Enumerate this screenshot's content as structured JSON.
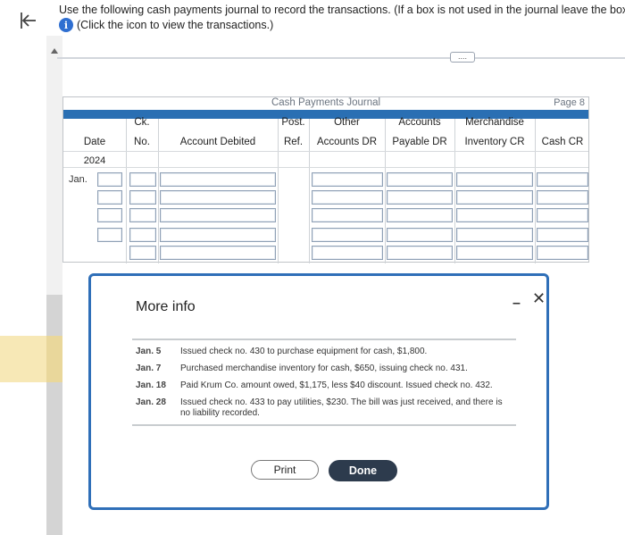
{
  "instructions": "Use the following cash payments journal to record the transactions. (If a box is not used in the journal leave the box empty; do not s",
  "info_link": "(Click the icon to view the transactions.)",
  "journal": {
    "title": "Cash Payments Journal",
    "page": "Page 8",
    "headers": {
      "date": "Date",
      "year": "2024",
      "ck_top": "Ck.",
      "ck_bottom": "No.",
      "account_debited": "Account Debited",
      "post_top": "Post.",
      "post_bottom": "Ref.",
      "other_top": "Other",
      "other_bottom": "Accounts DR",
      "ap_top": "Accounts",
      "ap_bottom": "Payable DR",
      "merch_top": "Merchandise",
      "merch_bottom": "Inventory CR",
      "cash": "Cash CR"
    },
    "month": "Jan."
  },
  "modal": {
    "title": "More info",
    "transactions": [
      {
        "date": "Jan. 5",
        "text": "Issued check no. 430 to purchase equipment for cash, $1,800."
      },
      {
        "date": "Jan. 7",
        "text": "Purchased merchandise inventory for cash, $650, issuing check no. 431."
      },
      {
        "date": "Jan. 18",
        "text": "Paid Krum Co. amount owed, $1,175, less $40 discount. Issued check no. 432."
      },
      {
        "date": "Jan. 28",
        "text": "Issued check no. 433 to pay utilities, $230. The bill was just received, and there is no liability recorded."
      }
    ],
    "print_label": "Print",
    "done_label": "Done"
  },
  "ellipsis": "....",
  "colors": {
    "accent": "#2f6fb8",
    "header_bar": "#2a6fb3",
    "done_button": "#2d3b4d"
  }
}
